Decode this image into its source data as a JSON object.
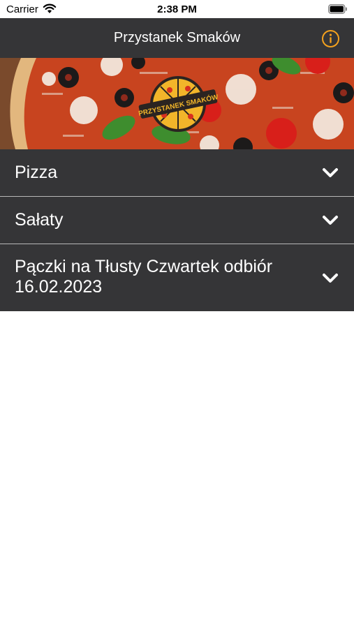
{
  "status_bar": {
    "carrier": "Carrier",
    "time": "2:38 PM"
  },
  "header": {
    "title": "Przystanek Smaków",
    "info_icon": "info-circle-icon",
    "accent_color": "#f4a21e"
  },
  "banner": {
    "logo_text": "PRZYSTANEK SMAKÓW"
  },
  "menu": {
    "items": [
      {
        "label": "Pizza",
        "icon": "chevron-down-icon"
      },
      {
        "label": "Sałaty",
        "icon": "chevron-down-icon"
      },
      {
        "label": "Pączki na Tłusty Czwartek odbiór 16.02.2023",
        "icon": "chevron-down-icon"
      }
    ]
  },
  "colors": {
    "bar_background": "#353537",
    "separator": "#b8b8b8",
    "text": "#ffffff"
  }
}
